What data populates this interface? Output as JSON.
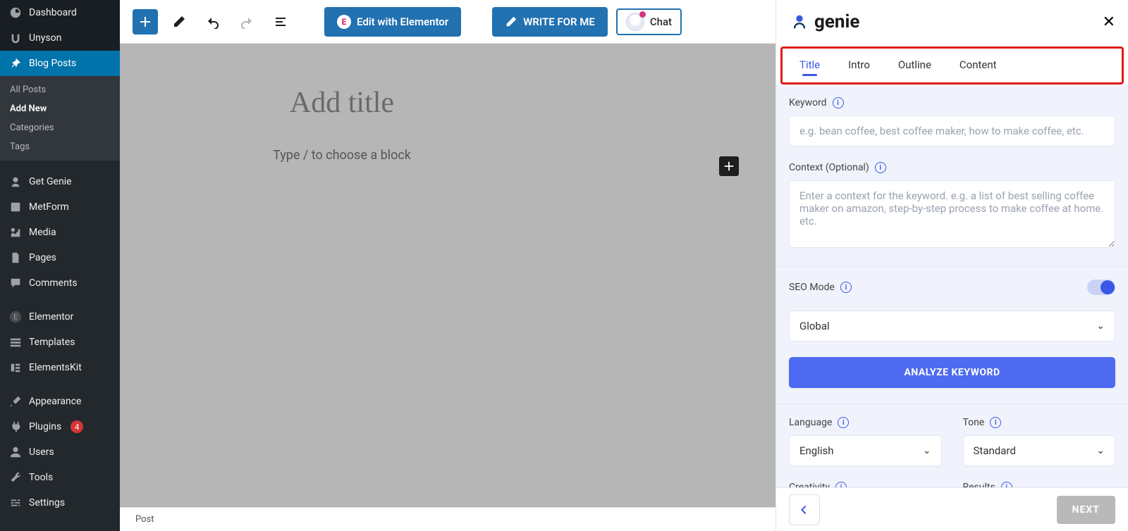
{
  "sidebar": {
    "items": [
      {
        "label": "Dashboard"
      },
      {
        "label": "Unyson"
      },
      {
        "label": "Blog Posts"
      },
      {
        "label": "Get Genie"
      },
      {
        "label": "MetForm"
      },
      {
        "label": "Media"
      },
      {
        "label": "Pages"
      },
      {
        "label": "Comments"
      },
      {
        "label": "Elementor"
      },
      {
        "label": "Templates"
      },
      {
        "label": "ElementsKit"
      },
      {
        "label": "Appearance"
      },
      {
        "label": "Plugins"
      },
      {
        "label": "Users"
      },
      {
        "label": "Tools"
      },
      {
        "label": "Settings"
      }
    ],
    "submenu": [
      {
        "label": "All Posts"
      },
      {
        "label": "Add New"
      },
      {
        "label": "Categories"
      },
      {
        "label": "Tags"
      }
    ],
    "plugins_badge": "4"
  },
  "toolbar": {
    "edit_elementor": "Edit with Elementor",
    "write_for_me": "WRITE FOR ME",
    "chat": "Chat"
  },
  "editor": {
    "title_placeholder": "Add title",
    "block_placeholder": "Type / to choose a block",
    "footer_tab": "Post"
  },
  "panel": {
    "brand": "genie",
    "tabs": [
      "Title",
      "Intro",
      "Outline",
      "Content"
    ],
    "keyword_label": "Keyword",
    "keyword_placeholder": "e.g. bean coffee, best coffee maker, how to make coffee, etc.",
    "context_label": "Context (Optional)",
    "context_placeholder": "Enter a context for the keyword. e.g. a list of best selling coffee maker on amazon, step-by-step process to make coffee at home. etc.",
    "seo_mode_label": "SEO Mode",
    "seo_scope": "Global",
    "analyze_label": "ANALYZE KEYWORD",
    "language_label": "Language",
    "language_value": "English",
    "tone_label": "Tone",
    "tone_value": "Standard",
    "creativity_label": "Creativity",
    "results_label": "Results",
    "next": "NEXT"
  }
}
